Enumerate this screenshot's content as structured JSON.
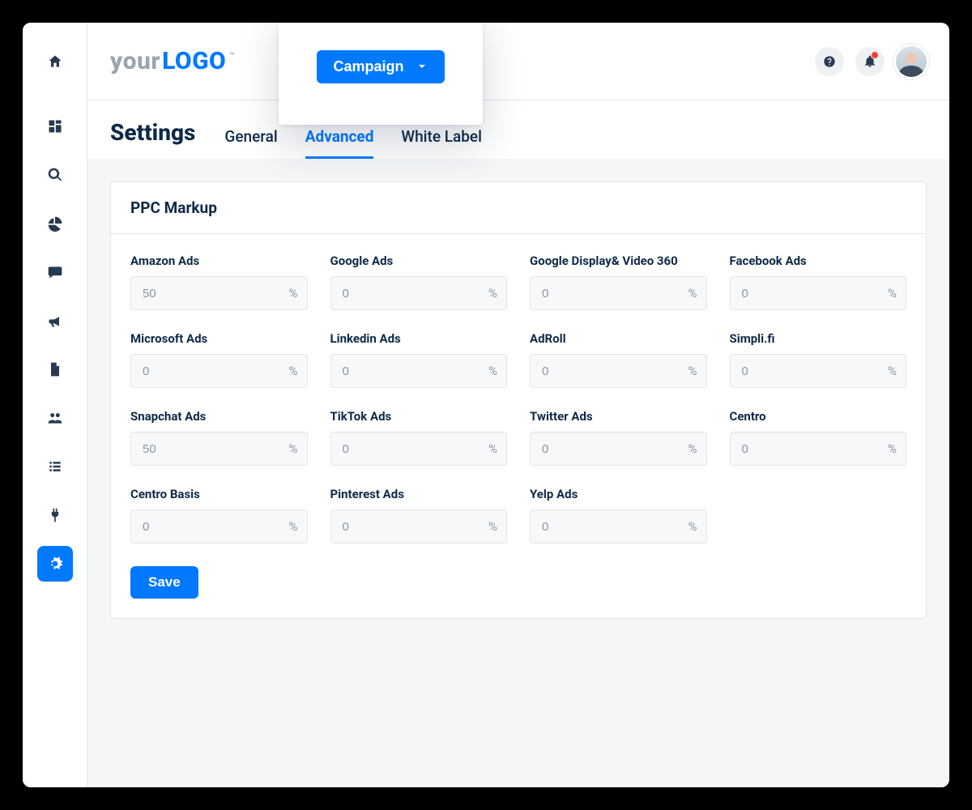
{
  "logo": {
    "part1": "your",
    "part2": "LOGO",
    "tm": "™"
  },
  "campaign_dropdown": {
    "label": "Campaign"
  },
  "topbar": {
    "help_tooltip": "?",
    "has_notification": true
  },
  "page": {
    "title": "Settings"
  },
  "tabs": [
    {
      "label": "General",
      "active": false
    },
    {
      "label": "Advanced",
      "active": true
    },
    {
      "label": "White Label",
      "active": false
    }
  ],
  "card": {
    "title": "PPC Markup",
    "unit": "%",
    "save_label": "Save",
    "fields": [
      {
        "label": "Amazon Ads",
        "value": "50"
      },
      {
        "label": "Google Ads",
        "value": "0"
      },
      {
        "label": "Google Display& Video 360",
        "value": "0"
      },
      {
        "label": "Facebook Ads",
        "value": "0"
      },
      {
        "label": "Microsoft Ads",
        "value": "0"
      },
      {
        "label": "Linkedin Ads",
        "value": "0"
      },
      {
        "label": "AdRoll",
        "value": "0"
      },
      {
        "label": "Simpli.fi",
        "value": "0"
      },
      {
        "label": "Snapchat Ads",
        "value": "50"
      },
      {
        "label": "TikTok Ads",
        "value": "0"
      },
      {
        "label": "Twitter Ads",
        "value": "0"
      },
      {
        "label": "Centro",
        "value": "0"
      },
      {
        "label": "Centro Basis",
        "value": "0"
      },
      {
        "label": "Pinterest Ads",
        "value": "0"
      },
      {
        "label": "Yelp Ads",
        "value": "0"
      }
    ]
  },
  "sidebar_icons": [
    "dashboard-icon",
    "search-icon",
    "piechart-icon",
    "chat-icon",
    "megaphone-icon",
    "file-icon",
    "users-icon",
    "list-icon",
    "plug-icon",
    "gear-icon"
  ]
}
